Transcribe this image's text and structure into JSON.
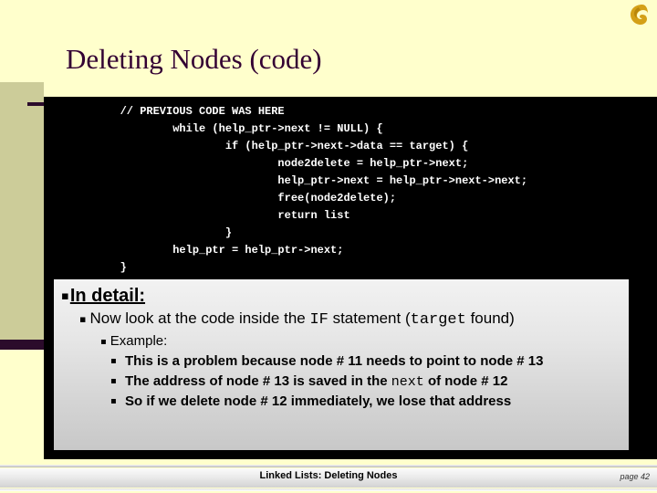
{
  "slide": {
    "title": "Deleting Nodes (code)",
    "logo_icon": "swirl-logo-icon",
    "colors": {
      "background": "#FFFFCC",
      "band": "#CCCC99",
      "accent": "#2B0B2B",
      "title_text": "#330033",
      "panel": "#000000",
      "code_text": "#FFFFFF",
      "logo": "#D4A017"
    }
  },
  "code_block": {
    "language": "c",
    "lines": [
      "   // PREVIOUS CODE WAS HERE",
      "           while (help_ptr->next != NULL) {",
      "                   if (help_ptr->next->data == target) {",
      "                           node2delete = help_ptr->next;",
      "                           help_ptr->next = help_ptr->next->next;",
      "                           free(node2delete);",
      "                           return list",
      "                   }",
      "           help_ptr = help_ptr->next;",
      "   }"
    ],
    "text": "   // PREVIOUS CODE WAS HERE\n           while (help_ptr->next != NULL) {\n                   if (help_ptr->next->data == target) {\n                           node2delete = help_ptr->next;\n                           help_ptr->next = help_ptr->next->next;\n                           free(node2delete);\n                           return list\n                   }\n           help_ptr = help_ptr->next;\n   }"
  },
  "content_box": {
    "bullet_glyph": "▪",
    "level1": {
      "text": "In detail:"
    },
    "level2": {
      "part1": "Now look at the code inside the ",
      "code1": "IF",
      "part2": " statement (",
      "code2": "target",
      "part3": " found)"
    },
    "level3": {
      "text": "Example:"
    },
    "level4": [
      {
        "part1": "This is a problem because node # 11 needs to point to node # 13",
        "code": "",
        "part2": ""
      },
      {
        "part1": "The address of node # 13 is saved in the ",
        "code": "next",
        "part2": " of node # 12"
      },
      {
        "part1": "So if we delete node # 12 immediately, we lose that address",
        "code": "",
        "part2": ""
      }
    ]
  },
  "footer": {
    "title": "Linked Lists:  Deleting Nodes",
    "page": "page 42"
  }
}
